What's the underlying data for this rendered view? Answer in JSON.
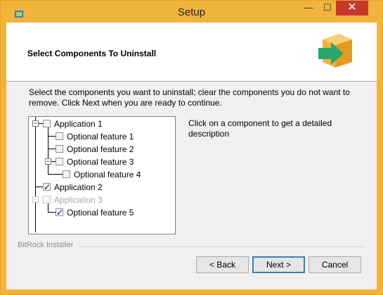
{
  "window": {
    "title": "Setup",
    "minimize_glyph": "—",
    "maximize_glyph": "☐",
    "close_glyph": "✕"
  },
  "header": {
    "title": "Select Components To Uninstall",
    "logo_icon": "box-arrow-icon",
    "logo_box_color": "#f5b53f",
    "logo_arrow_color": "#2aa66c"
  },
  "instructions": "Select the components you want to uninstall; clear the components you do not want to remove. Click Next when you are ready to continue.",
  "tree": {
    "items": [
      {
        "label": "Application 1",
        "checked": false,
        "disabled": false,
        "level": 0,
        "expander": "−"
      },
      {
        "label": "Optional feature 1",
        "checked": false,
        "disabled": false,
        "level": 1
      },
      {
        "label": "Optional feature 2",
        "checked": false,
        "disabled": false,
        "level": 1
      },
      {
        "label": "Optional feature 3",
        "checked": false,
        "disabled": false,
        "level": 1,
        "expander": "−"
      },
      {
        "label": "Optional feature 4",
        "checked": false,
        "disabled": false,
        "level": 2
      },
      {
        "label": "Application 2",
        "checked": true,
        "disabled": false,
        "level": 0
      },
      {
        "label": "Application 3",
        "checked": false,
        "disabled": true,
        "level": 0,
        "expander": "−"
      },
      {
        "label": "Optional feature 5",
        "checked": true,
        "disabled": false,
        "level": 1
      }
    ]
  },
  "description": "Click on a component to get a detailed description",
  "footer": {
    "installer_label": "BitRock Installer"
  },
  "buttons": {
    "back": "< Back",
    "next": "Next >",
    "cancel": "Cancel"
  }
}
